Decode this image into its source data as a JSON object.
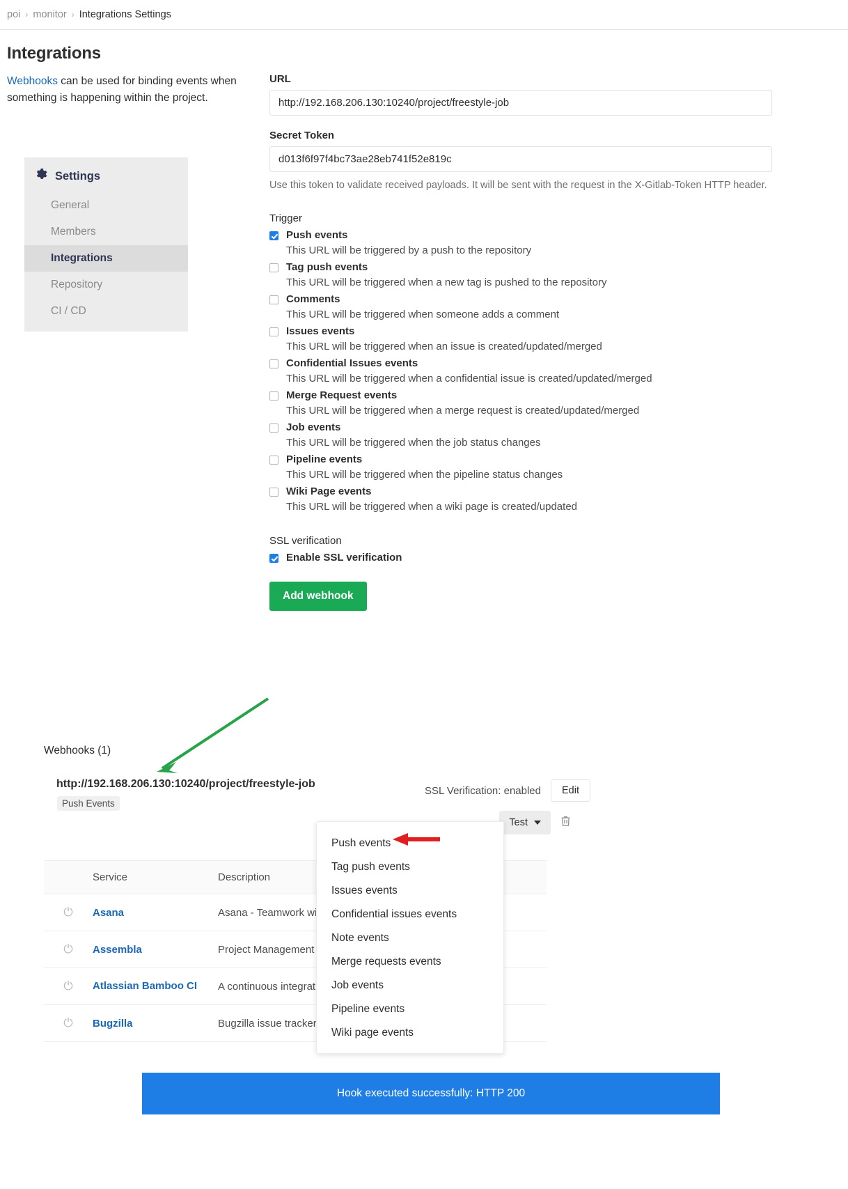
{
  "breadcrumb": {
    "items": [
      "poi",
      "monitor",
      "Integrations Settings"
    ],
    "separator": "›"
  },
  "left": {
    "title": "Integrations",
    "intro_link": "Webhooks",
    "intro_rest": " can be used for binding events when something is happening within the project."
  },
  "sidebar": {
    "header": "Settings",
    "header_icon": "gear-icon",
    "items": [
      {
        "label": "General",
        "active": false
      },
      {
        "label": "Members",
        "active": false
      },
      {
        "label": "Integrations",
        "active": true
      },
      {
        "label": "Repository",
        "active": false
      },
      {
        "label": "CI / CD",
        "active": false
      }
    ]
  },
  "form": {
    "url_label": "URL",
    "url_value": "http://192.168.206.130:10240/project/freestyle-job",
    "token_label": "Secret Token",
    "token_value": "d013f6f97f4bc73ae28eb741f52e819c",
    "token_help": "Use this token to validate received payloads. It will be sent with the request in the X-Gitlab-Token HTTP header.",
    "trigger_label": "Trigger",
    "triggers": [
      {
        "label": "Push events",
        "desc": "This URL will be triggered by a push to the repository",
        "checked": true
      },
      {
        "label": "Tag push events",
        "desc": "This URL will be triggered when a new tag is pushed to the repository",
        "checked": false
      },
      {
        "label": "Comments",
        "desc": "This URL will be triggered when someone adds a comment",
        "checked": false
      },
      {
        "label": "Issues events",
        "desc": "This URL will be triggered when an issue is created/updated/merged",
        "checked": false
      },
      {
        "label": "Confidential Issues events",
        "desc": "This URL will be triggered when a confidential issue is created/updated/merged",
        "checked": false
      },
      {
        "label": "Merge Request events",
        "desc": "This URL will be triggered when a merge request is created/updated/merged",
        "checked": false
      },
      {
        "label": "Job events",
        "desc": "This URL will be triggered when the job status changes",
        "checked": false
      },
      {
        "label": "Pipeline events",
        "desc": "This URL will be triggered when the pipeline status changes",
        "checked": false
      },
      {
        "label": "Wiki Page events",
        "desc": "This URL will be triggered when a wiki page is created/updated",
        "checked": false
      }
    ],
    "ssl_label": "SSL verification",
    "ssl_checkbox_label": "Enable SSL verification",
    "ssl_checked": true,
    "add_button": "Add webhook"
  },
  "webhooks": {
    "heading": "Webhooks (1)",
    "url": "http://192.168.206.130:10240/project/freestyle-job",
    "badge": "Push Events",
    "ssl_status": "SSL Verification: enabled",
    "edit_label": "Edit",
    "test_label": "Test",
    "delete_icon": "trash-icon"
  },
  "test_dropdown": {
    "items": [
      "Push events",
      "Tag push events",
      "Issues events",
      "Confidential issues events",
      "Note events",
      "Merge requests events",
      "Job events",
      "Pipeline events",
      "Wiki page events"
    ]
  },
  "services": {
    "headers": [
      "",
      "Service",
      "Description",
      ""
    ],
    "rows": [
      {
        "icon": "power-icon",
        "name": "Asana",
        "description": "Asana - Teamwork without email"
      },
      {
        "icon": "power-icon",
        "name": "Assembla",
        "description": "Project Management Software (Source Commits Endpoint)"
      },
      {
        "icon": "power-icon",
        "name": "Atlassian Bamboo CI",
        "description": "A continuous integration and build server"
      },
      {
        "icon": "power-icon",
        "name": "Bugzilla",
        "description": "Bugzilla issue tracker"
      }
    ]
  },
  "toast": {
    "message": "Hook executed successfully: HTTP 200",
    "color": "#1f7ee6"
  },
  "annotations": {
    "green_arrow_color": "#27a34a",
    "red_arrow_color": "#e02020"
  }
}
